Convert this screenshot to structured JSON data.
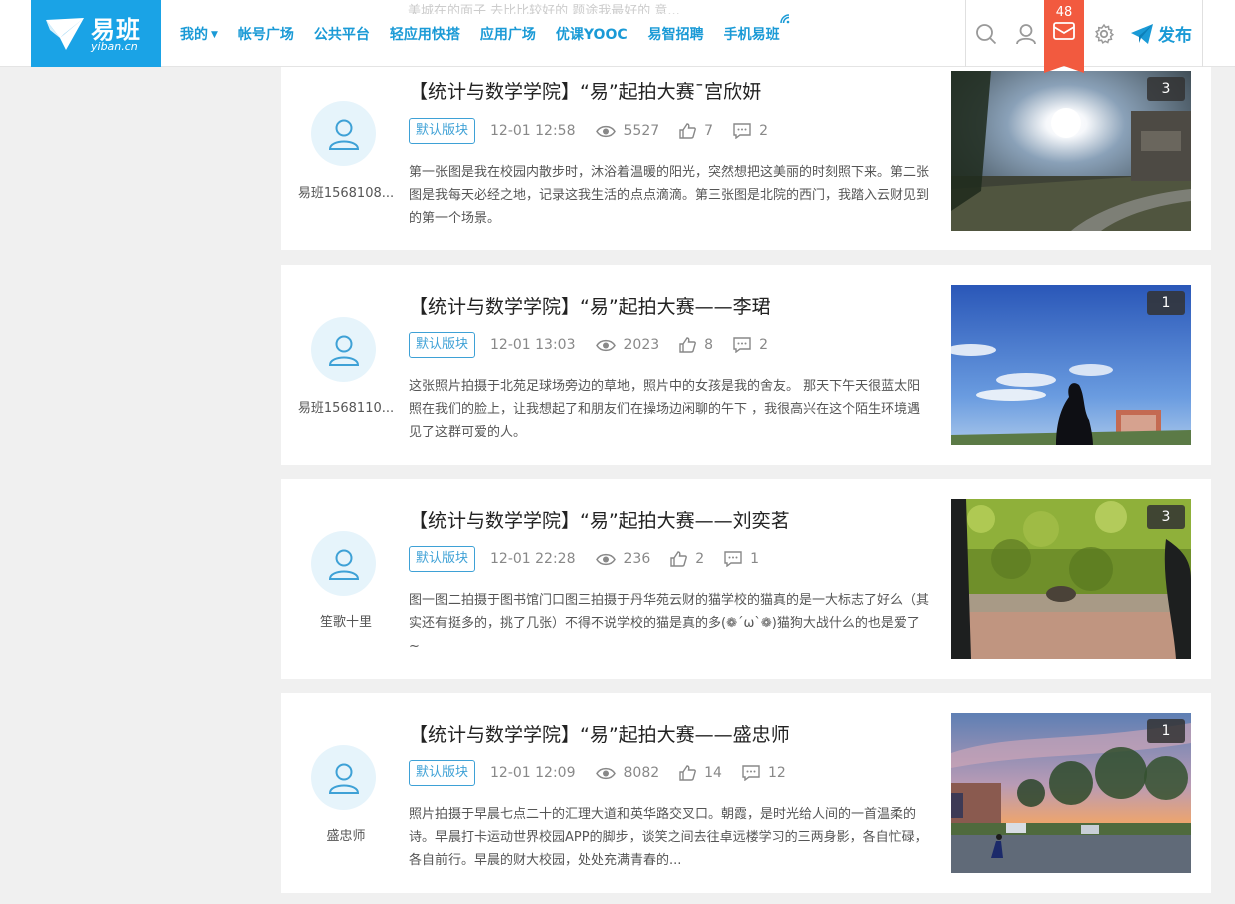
{
  "header": {
    "logo_text": "易班",
    "logo_sub": "yiban.cn",
    "nav": [
      "我的",
      "帐号广场",
      "公共平台",
      "轻应用快搭",
      "应用广场",
      "优课YOOC",
      "易智招聘",
      "手机易班"
    ],
    "mail_count": "48",
    "publish_label": "发布",
    "accent": "#1aa3e6",
    "badge_color": "#f25a3f"
  },
  "top_fragment": "美城在的面子 去比比较好的 题途我最好的 意...",
  "posts": [
    {
      "author": "易班1568108...",
      "title": "【统计与数学学院】“易”起拍大赛¯宫欣妍",
      "tag": "默认版块",
      "time": "12-01 12:58",
      "views": "5527",
      "likes": "7",
      "comments": "2",
      "excerpt": "第一张图是我在校园内散步时，沐浴着温暖的阳光，突然想把这美丽的时刻照下来。第二张图是我每天必经之地，记录这我生活的点点滴滴。第三张图是北院的西门，我踏入云财见到的第一个场景。",
      "image_count": "3"
    },
    {
      "author": "易班1568110...",
      "title": "【统计与数学学院】“易”起拍大赛——李珺",
      "tag": "默认版块",
      "time": "12-01 13:03",
      "views": "2023",
      "likes": "8",
      "comments": "2",
      "excerpt": "这张照片拍摄于北苑足球场旁边的草地，照片中的女孩是我的舍友。  那天下午天很蓝太阳照在我们的脸上，让我想起了和朋友们在操场边闲聊的午下 ，我很高兴在这个陌生环境遇见了这群可爱的人。",
      "image_count": "1"
    },
    {
      "author": "笙歌十里",
      "title": "【统计与数学学院】“易”起拍大赛——刘奕茗",
      "tag": "默认版块",
      "time": "12-01 22:28",
      "views": "236",
      "likes": "2",
      "comments": "1",
      "excerpt": "图一图二拍摄于图书馆门口图三拍摄于丹华苑云财的猫学校的猫真的是一大标志了好么（其实还有挺多的，挑了几张）不得不说学校的猫是真的多(❁´ω`❁)猫狗大战什么的也是爱了~",
      "image_count": "3"
    },
    {
      "author": "盛忠师",
      "title": "【统计与数学学院】“易”起拍大赛——盛忠师",
      "tag": "默认版块",
      "time": "12-01 12:09",
      "views": "8082",
      "likes": "14",
      "comments": "12",
      "excerpt": "照片拍摄于早晨七点二十的汇理大道和英华路交叉口。朝霞，是时光给人间的一首温柔的诗。早晨打卡运动世界校园APP的脚步，谈笑之间去往卓远楼学习的三两身影，各自忙碌，各自前行。早晨的财大校园，处处充满青春的...",
      "image_count": "1"
    }
  ]
}
